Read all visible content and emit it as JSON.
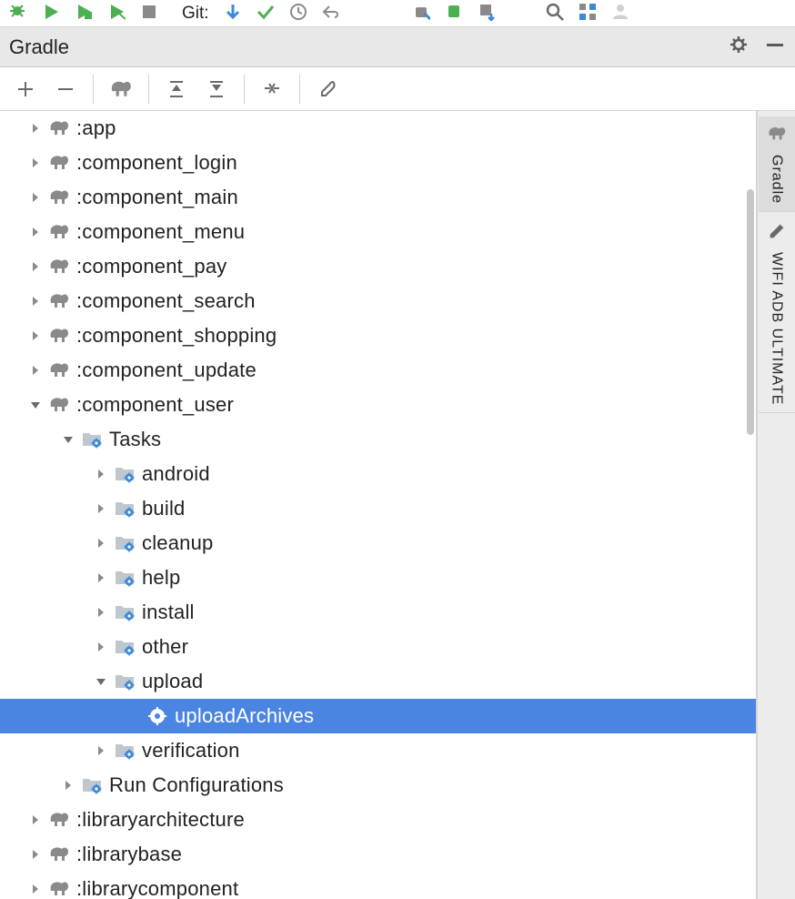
{
  "topToolbar": {
    "gitLabel": "Git:"
  },
  "panel": {
    "title": "Gradle"
  },
  "rightTabs": [
    {
      "label": "Gradle",
      "icon": "elephant",
      "active": true
    },
    {
      "label": "WIFI ADB ULTIMATE",
      "icon": "wifi-pencil",
      "active": false
    }
  ],
  "tree": [
    {
      "depth": 0,
      "expanded": false,
      "icon": "elephant",
      "label": ":app",
      "selected": false
    },
    {
      "depth": 0,
      "expanded": false,
      "icon": "elephant",
      "label": ":component_login",
      "selected": false
    },
    {
      "depth": 0,
      "expanded": false,
      "icon": "elephant",
      "label": ":component_main",
      "selected": false
    },
    {
      "depth": 0,
      "expanded": false,
      "icon": "elephant",
      "label": ":component_menu",
      "selected": false
    },
    {
      "depth": 0,
      "expanded": false,
      "icon": "elephant",
      "label": ":component_pay",
      "selected": false
    },
    {
      "depth": 0,
      "expanded": false,
      "icon": "elephant",
      "label": ":component_search",
      "selected": false
    },
    {
      "depth": 0,
      "expanded": false,
      "icon": "elephant",
      "label": ":component_shopping",
      "selected": false
    },
    {
      "depth": 0,
      "expanded": false,
      "icon": "elephant",
      "label": ":component_update",
      "selected": false
    },
    {
      "depth": 0,
      "expanded": true,
      "icon": "elephant",
      "label": ":component_user",
      "selected": false
    },
    {
      "depth": 1,
      "expanded": true,
      "icon": "folder-gear",
      "label": "Tasks",
      "selected": false
    },
    {
      "depth": 2,
      "expanded": false,
      "icon": "folder-gear",
      "label": "android",
      "selected": false
    },
    {
      "depth": 2,
      "expanded": false,
      "icon": "folder-gear",
      "label": "build",
      "selected": false
    },
    {
      "depth": 2,
      "expanded": false,
      "icon": "folder-gear",
      "label": "cleanup",
      "selected": false
    },
    {
      "depth": 2,
      "expanded": false,
      "icon": "folder-gear",
      "label": "help",
      "selected": false
    },
    {
      "depth": 2,
      "expanded": false,
      "icon": "folder-gear",
      "label": "install",
      "selected": false
    },
    {
      "depth": 2,
      "expanded": false,
      "icon": "folder-gear",
      "label": "other",
      "selected": false
    },
    {
      "depth": 2,
      "expanded": true,
      "icon": "folder-gear",
      "label": "upload",
      "selected": false
    },
    {
      "depth": 3,
      "expanded": null,
      "icon": "task-gear",
      "label": "uploadArchives",
      "selected": true
    },
    {
      "depth": 2,
      "expanded": false,
      "icon": "folder-gear",
      "label": "verification",
      "selected": false
    },
    {
      "depth": 1,
      "expanded": false,
      "icon": "folder-gear",
      "label": "Run Configurations",
      "selected": false
    },
    {
      "depth": 0,
      "expanded": false,
      "icon": "elephant",
      "label": ":libraryarchitecture",
      "selected": false
    },
    {
      "depth": 0,
      "expanded": false,
      "icon": "elephant",
      "label": ":librarybase",
      "selected": false
    },
    {
      "depth": 0,
      "expanded": false,
      "icon": "elephant",
      "label": ":librarycomponent",
      "selected": false
    }
  ]
}
